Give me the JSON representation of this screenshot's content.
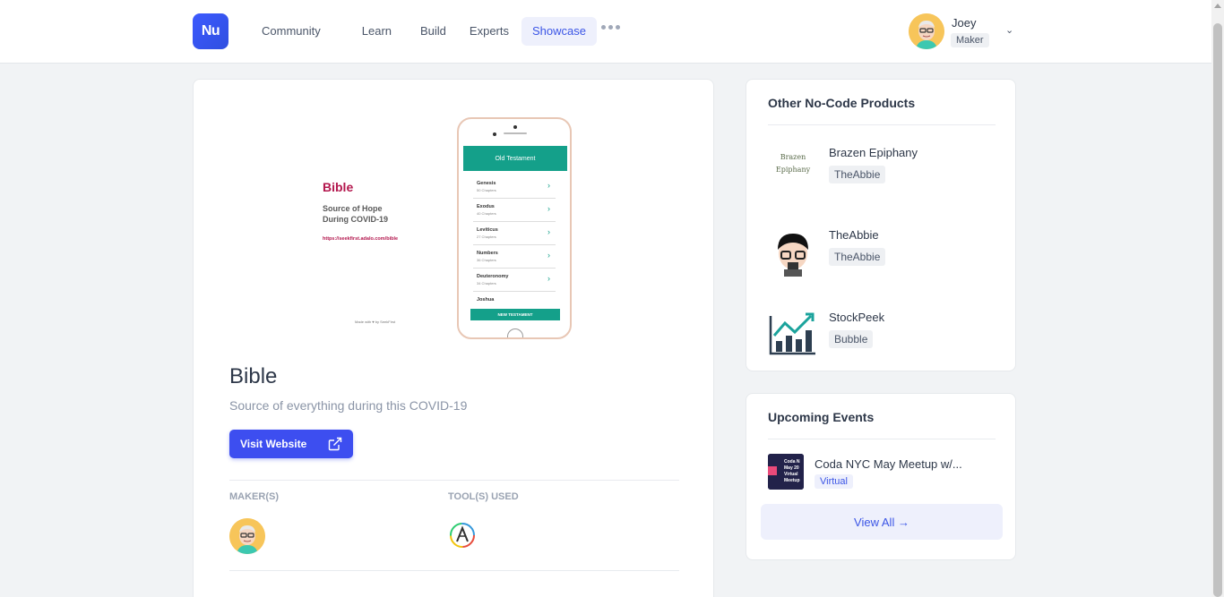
{
  "header": {
    "logo": "Nu",
    "nav": [
      "Community",
      "Learn",
      "Build",
      "Experts",
      "Showcase"
    ],
    "user_name": "Joey",
    "user_role": "Maker"
  },
  "product": {
    "hero": {
      "title": "Bible",
      "subtitle_line1": "Source of Hope",
      "subtitle_line2": "During COVID-19",
      "url": "https://seekfirst.adalo.com/bible",
      "made_with": "Made with ♥ by SeekFirst",
      "phone_header": "Old Testament",
      "books": [
        {
          "name": "Genesis",
          "chapters": "50 Chapters"
        },
        {
          "name": "Exodus",
          "chapters": "40 Chapters"
        },
        {
          "name": "Leviticus",
          "chapters": "27 Chapters"
        },
        {
          "name": "Numbers",
          "chapters": "36 Chapters"
        },
        {
          "name": "Deuteronomy",
          "chapters": "34 Chapters"
        },
        {
          "name": "Joshua",
          "chapters": ""
        }
      ],
      "phone_button": "NEW TESTAMENT"
    },
    "title": "Bible",
    "tagline": "Source of everything during this COVID-19",
    "visit_label": "Visit Website",
    "makers_label": "MAKER(S)",
    "tools_label": "TOOL(S) USED"
  },
  "sidebar": {
    "products_title": "Other No-Code Products",
    "products": [
      {
        "name": "Brazen Epiphany",
        "tool": "TheAbbie",
        "logo_text_1": "Brazen",
        "logo_text_2": "Epiphany"
      },
      {
        "name": "TheAbbie",
        "tool": "TheAbbie"
      },
      {
        "name": "StockPeek",
        "tool": "Bubble"
      }
    ],
    "events_title": "Upcoming Events",
    "event": {
      "name": "Coda NYC May Meetup w/...",
      "tag": "Virtual",
      "thumb_lines": [
        "Coda N",
        "May 20",
        "Virtual",
        "Meetup"
      ]
    },
    "view_all": "View All →"
  },
  "colors": {
    "accent": "#3d4ef0",
    "teal": "#14a08a",
    "bible_red": "#b3164d"
  }
}
